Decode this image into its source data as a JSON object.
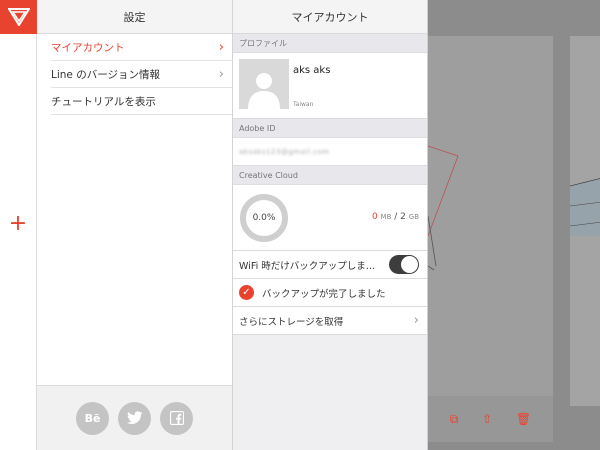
{
  "settings": {
    "title": "設定",
    "items": [
      {
        "label": "マイアカウント",
        "active": true,
        "chevron": true
      },
      {
        "label": "Line のバージョン情報",
        "active": false,
        "chevron": true
      },
      {
        "label": "チュートリアルを表示",
        "active": false,
        "chevron": false
      }
    ],
    "social": [
      {
        "label": "Bē",
        "icon": "behance-icon"
      },
      {
        "label": "",
        "icon": "twitter-icon"
      },
      {
        "label": "",
        "icon": "facebook-icon"
      }
    ]
  },
  "account": {
    "title": "マイアカウント",
    "profile_section": "プロファイル",
    "profile_name": "aks aks",
    "profile_location": "Taiwan",
    "adobe_id_section": "Adobe ID",
    "adobe_id_value": "aksaks123@gmail.com",
    "cc_section": "Creative Cloud",
    "usage_percent": "0.0%",
    "storage_used": "0",
    "storage_used_unit": "MB",
    "storage_separator": " / ",
    "storage_total": "2",
    "storage_total_unit": "GB",
    "wifi_backup_label": "WiFi 時だけバックアップしま…",
    "wifi_backup_on": true,
    "backup_done_label": "バックアップが完了しました",
    "more_storage_label": "さらにストレージを取得"
  },
  "colors": {
    "accent": "#e8432e",
    "toggle_on": "#3d3d3d"
  }
}
